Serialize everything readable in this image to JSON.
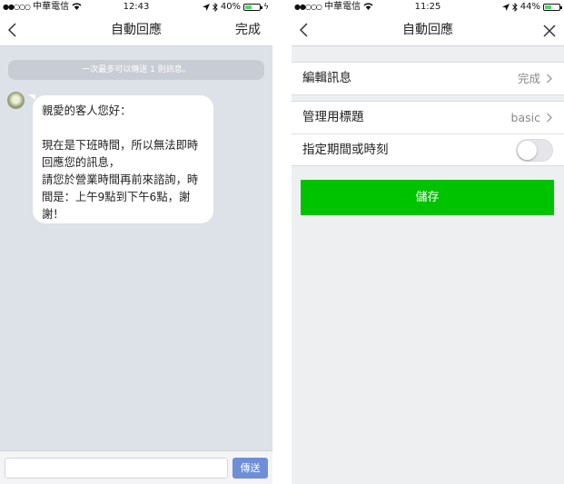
{
  "left": {
    "status": {
      "carrier": "中華電信",
      "time": "12:43",
      "battery": "40%",
      "battery_level": 0.4
    },
    "nav": {
      "title": "自動回應",
      "action_label": "完成"
    },
    "notice": "一次最多可以傳送 1 則訊息。",
    "message": "親愛的客人您好：\n\n現在是下班時間，所以無法即時回應您的訊息，\n請您於營業時間再前來諮詢，時間是：上午9點到下午6點，謝謝！",
    "input": {
      "value": "",
      "placeholder": ""
    },
    "send_label": "傳送"
  },
  "right": {
    "status": {
      "carrier": "中華電信",
      "time": "11:25",
      "battery": "44%",
      "battery_level": 0.44
    },
    "nav": {
      "title": "自動回應"
    },
    "rows": [
      {
        "label": "編輯訊息",
        "value": "完成"
      },
      {
        "label": "管理用標題",
        "value": "basic"
      },
      {
        "label": "指定期間或時刻",
        "toggle_on": false
      }
    ],
    "save_label": "儲存"
  },
  "colors": {
    "save_green": "#00c300",
    "send_blue": "#6e8fd8",
    "chat_bg": "#dde1e8"
  },
  "icons": [
    "back-chevron-icon",
    "close-icon",
    "wifi-icon",
    "location-arrow-icon",
    "bluetooth-icon",
    "battery-icon",
    "chevron-right-icon"
  ]
}
